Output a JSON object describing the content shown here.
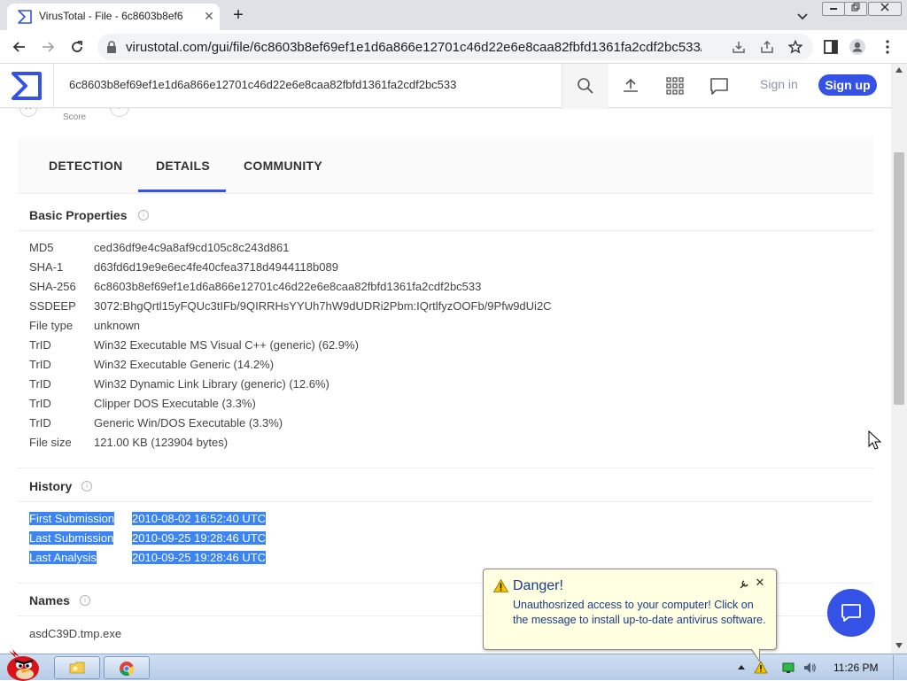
{
  "browser": {
    "tab_title": "VirusTotal - File - 6c8603b8ef6",
    "tab_close": "✕",
    "new_tab": "+",
    "url": "virustotal.com/gui/file/6c8603b8ef69ef1e1d6a866e12701c46d22e6e8caa82fbfd1361fa2cdf2bc533/..."
  },
  "header": {
    "search_value": "6c8603b8ef69ef1e1d6a866e12701c46d22e6e8caa82fbfd1361fa2cdf2bc533",
    "sign_in": "Sign in",
    "sign_up": "Sign up"
  },
  "score": {
    "label": "Score"
  },
  "tabs": [
    "DETECTION",
    "DETAILS",
    "COMMUNITY"
  ],
  "active_tab": "DETAILS",
  "basic_properties": {
    "title": "Basic Properties",
    "rows": [
      {
        "key": "MD5",
        "value": "ced36df9e4c9a8af9cd105c8c243d861"
      },
      {
        "key": "SHA-1",
        "value": "d63fd6d19e9e6ec4fe40cfea3718d4944118b089"
      },
      {
        "key": "SHA-256",
        "value": "6c8603b8ef69ef1e1d6a866e12701c46d22e6e8caa82fbfd1361fa2cdf2bc533"
      },
      {
        "key": "SSDEEP",
        "value": "3072:BhgQrtl15yFQUc3tIFb/9QIRRHsYYUh7hW9dUDRi2Pbm:IQrtlfyzOOFb/9Pfw9dUi2C"
      },
      {
        "key": "File type",
        "value": "unknown"
      },
      {
        "key": "TrID",
        "value": "Win32 Executable MS Visual C++ (generic) (62.9%)"
      },
      {
        "key": "TrID",
        "value": "Win32 Executable Generic (14.2%)"
      },
      {
        "key": "TrID",
        "value": "Win32 Dynamic Link Library (generic) (12.6%)"
      },
      {
        "key": "TrID",
        "value": "Clipper DOS Executable (3.3%)"
      },
      {
        "key": "TrID",
        "value": "Generic Win/DOS Executable (3.3%)"
      },
      {
        "key": "File size",
        "value": "121.00 KB (123904 bytes)"
      }
    ]
  },
  "history": {
    "title": "History",
    "rows": [
      {
        "key": "First Submission",
        "value": "2010-08-02 16:52:40 UTC"
      },
      {
        "key": "Last Submission",
        "value": "2010-09-25 19:28:46 UTC"
      },
      {
        "key": "Last Analysis",
        "value": "2010-09-25 19:28:46 UTC"
      }
    ]
  },
  "names": {
    "title": "Names",
    "rows": [
      "asdC39D.tmp.exe"
    ]
  },
  "balloon": {
    "title": "Danger!",
    "message": "Unauthosrized access to your computer! Click on the message to install up-to-date antivirus software.",
    "close": "✕"
  },
  "taskbar": {
    "clock": "11:26 PM"
  },
  "colors": {
    "accent": "#3452e6",
    "selection": "#3b84f5",
    "balloon_bg": "#ffffe1",
    "balloon_text": "#1a3a8c"
  }
}
